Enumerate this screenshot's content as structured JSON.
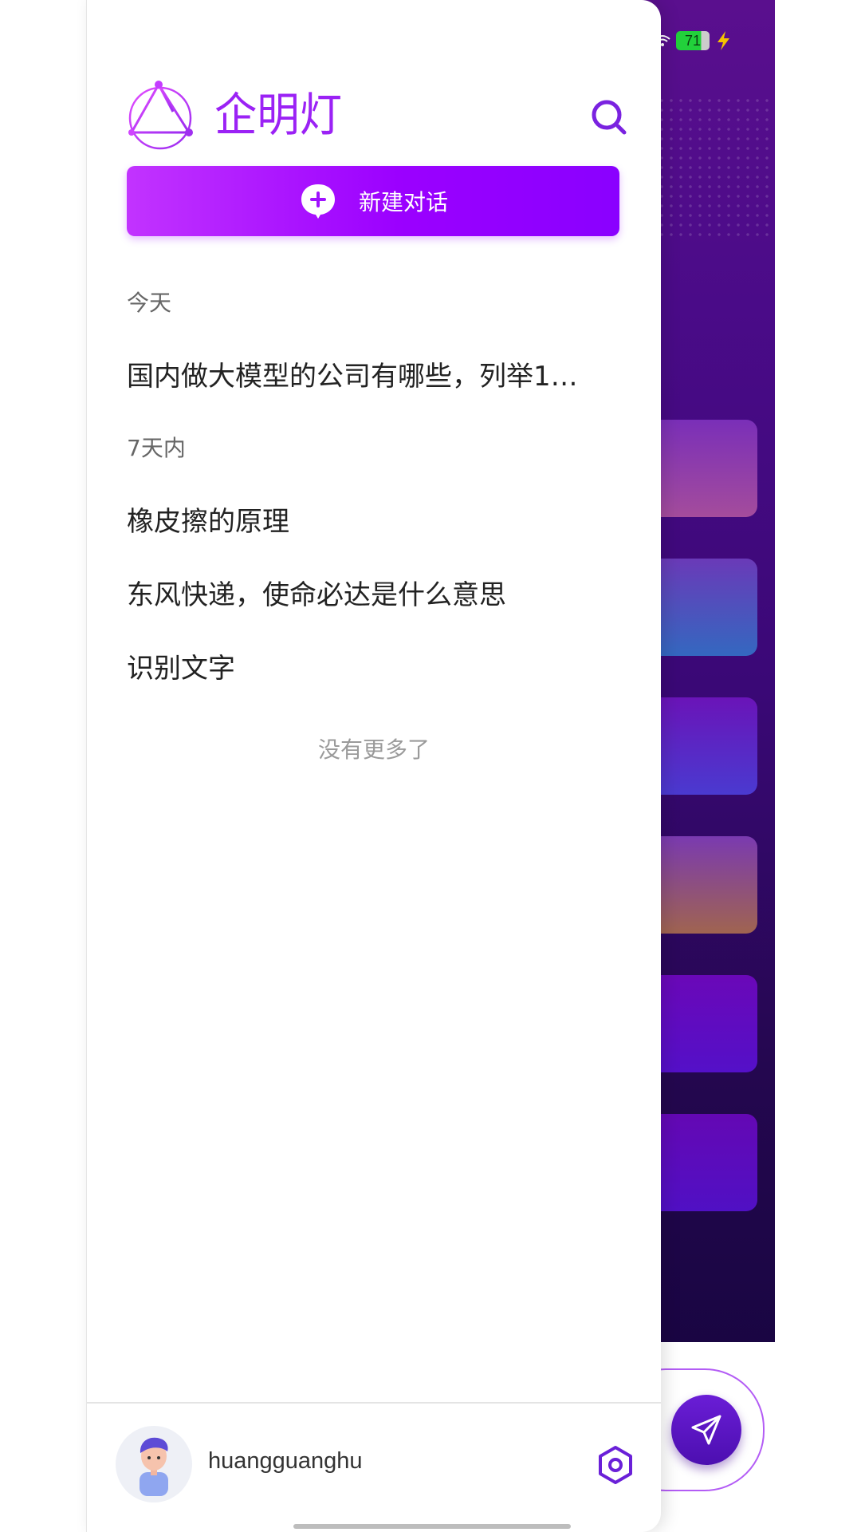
{
  "status_bar": {
    "battery_level": "71",
    "colors": {
      "battery_fill": "#22d13b",
      "bolt": "#f5c400"
    }
  },
  "app": {
    "logo_icon": "triangle-logo-icon",
    "title": "企明灯",
    "accent_color": "#9b00ff"
  },
  "drawer": {
    "new_chat_label": "新建对话",
    "sections": [
      {
        "label": "今天",
        "items": [
          "国内做大模型的公司有哪些，列举1…"
        ]
      },
      {
        "label": "7天内",
        "items": [
          "橡皮擦的原理",
          "东风快递，使命必达是什么意思",
          "识别文字"
        ]
      }
    ],
    "no_more_text": "没有更多了",
    "footer": {
      "username": "huangguanghu",
      "settings_icon": "hexagon-gear-icon"
    }
  }
}
